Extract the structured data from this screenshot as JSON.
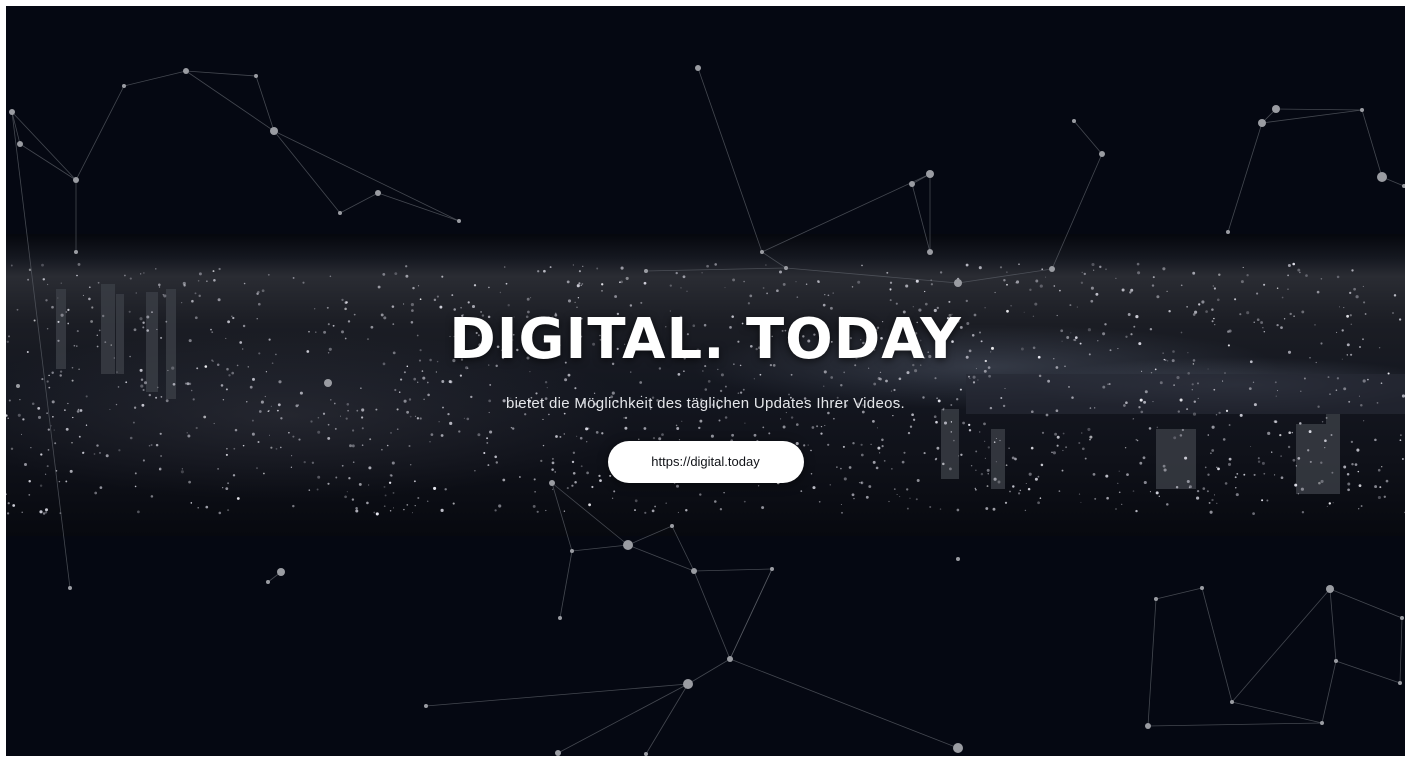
{
  "hero": {
    "title": "DIGITAL. TODAY",
    "subtitle": "bietet die Möglichkeit des täglichen Updates Ihrer Videos.",
    "button_label": "https://digital.today"
  },
  "colors": {
    "background": "#050812",
    "text": "#ffffff",
    "button_bg": "#ffffff",
    "button_text": "#111318",
    "network_line": "#5a5e66",
    "network_node": "#9a9ca2"
  },
  "icons": [
    "network-constellation-decoration",
    "city-skyline-background"
  ]
}
